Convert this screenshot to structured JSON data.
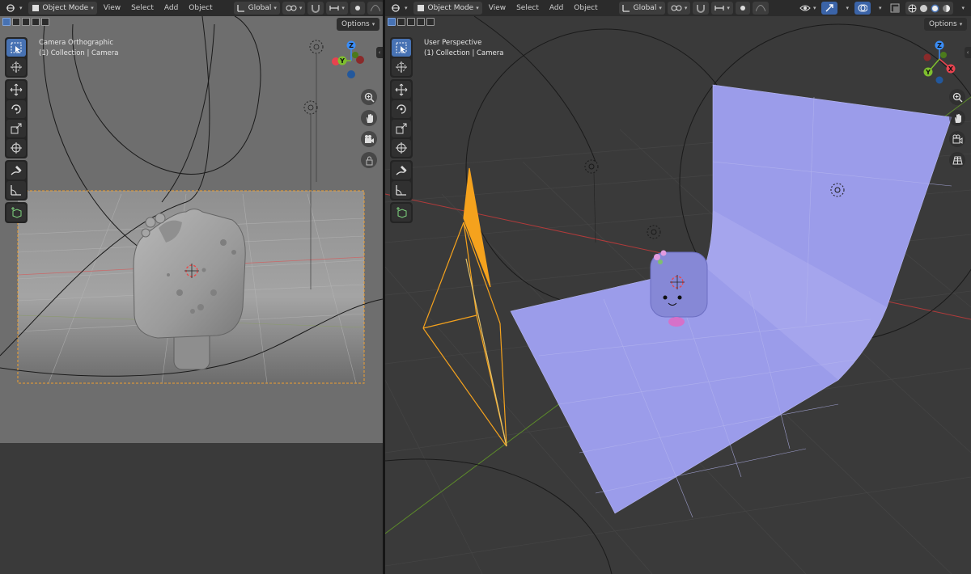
{
  "header": {
    "mode_label": "Object Mode",
    "menus": [
      "View",
      "Select",
      "Add",
      "Object"
    ],
    "orientation_label": "Global",
    "options_label": "Options"
  },
  "left_viewport": {
    "view_name": "Camera Orthographic",
    "collection_info": "(1) Collection | Camera"
  },
  "right_viewport": {
    "view_name": "User Perspective",
    "collection_info": "(1) Collection | Camera"
  },
  "gizmo": {
    "x": "X",
    "y": "Y",
    "z": "Z"
  },
  "toolbar": [
    "select-box",
    "cursor",
    "move",
    "rotate",
    "scale",
    "transform",
    "annotate",
    "measure",
    "add-cube"
  ],
  "colors": {
    "accent": "#4772b3",
    "camera_selected": "#f5a21d",
    "axis_x": "#e8434f",
    "axis_y": "#7ebf2e",
    "axis_z": "#3a8df7",
    "backdrop": "#9b9cea",
    "character": "#8688d6"
  }
}
